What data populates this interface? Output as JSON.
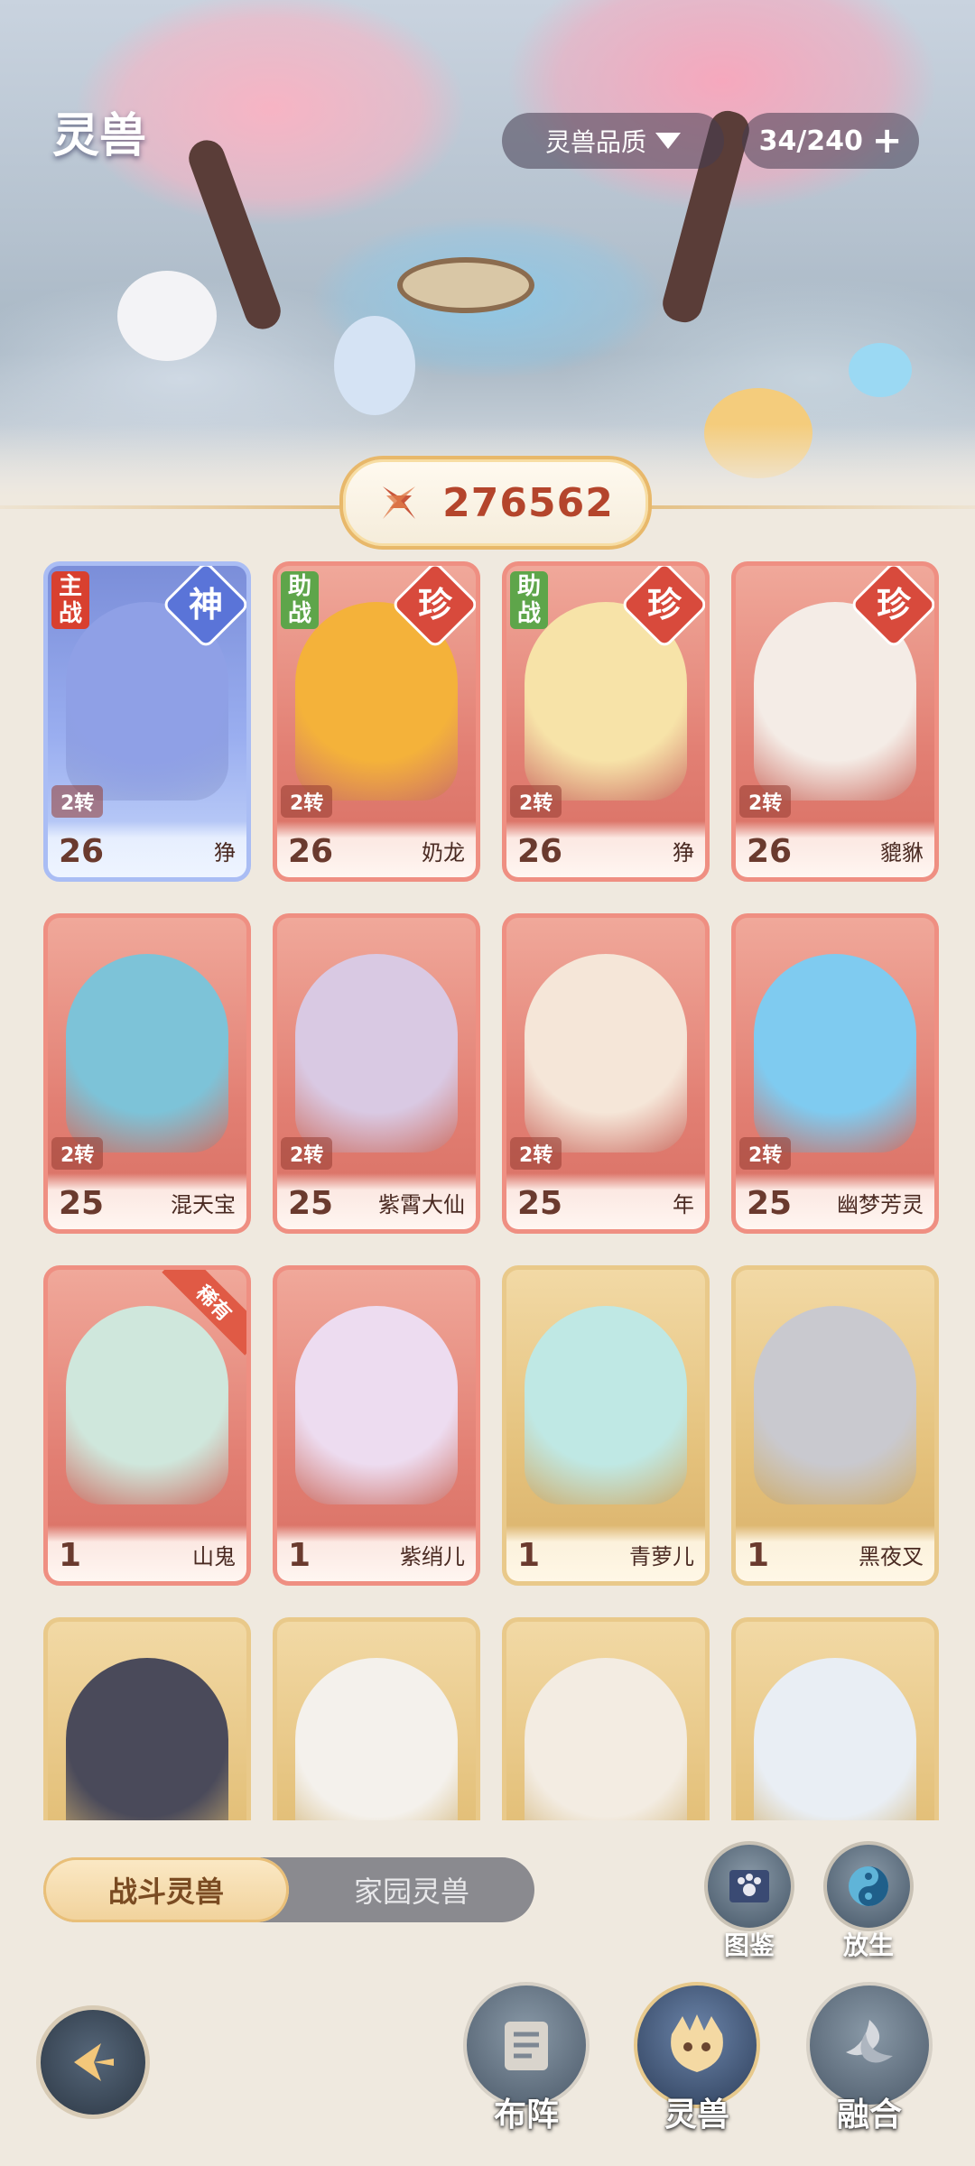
{
  "header": {
    "title": "灵兽",
    "quality_filter": "灵兽品质",
    "capacity": "34/240"
  },
  "power": {
    "value": "276562"
  },
  "cards": [
    {
      "name": "狰",
      "level": "26",
      "rebirth": "2转",
      "tier": "神",
      "role": "主战",
      "style": "blue",
      "color": "#8fa0e6"
    },
    {
      "name": "奶龙",
      "level": "26",
      "rebirth": "2转",
      "tier": "珍",
      "role": "助战",
      "style": "red",
      "color": "#f4b23a"
    },
    {
      "name": "狰",
      "level": "26",
      "rebirth": "2转",
      "tier": "珍",
      "role": "助战",
      "style": "red",
      "color": "#f7e3a8"
    },
    {
      "name": "貔貅",
      "level": "26",
      "rebirth": "2转",
      "tier": "珍",
      "role": "",
      "style": "red",
      "color": "#f4ece6"
    },
    {
      "name": "混天宝",
      "level": "25",
      "rebirth": "2转",
      "tier": "",
      "role": "",
      "style": "red",
      "color": "#7dc3d8"
    },
    {
      "name": "紫霄大仙",
      "level": "25",
      "rebirth": "2转",
      "tier": "",
      "role": "",
      "style": "red",
      "color": "#d9c9e3"
    },
    {
      "name": "年",
      "level": "25",
      "rebirth": "2转",
      "tier": "",
      "role": "",
      "style": "red",
      "color": "#f5e6d8"
    },
    {
      "name": "幽梦芳灵",
      "level": "25",
      "rebirth": "2转",
      "tier": "",
      "role": "",
      "style": "red",
      "color": "#7fcbf0"
    },
    {
      "name": "山鬼",
      "level": "1",
      "rebirth": "",
      "tier": "",
      "role": "",
      "rare": "稀有",
      "style": "red",
      "color": "#cfe7dc"
    },
    {
      "name": "紫绡儿",
      "level": "1",
      "rebirth": "",
      "tier": "",
      "role": "",
      "style": "red",
      "color": "#eddcf0"
    },
    {
      "name": "青萝儿",
      "level": "1",
      "rebirth": "",
      "tier": "",
      "role": "",
      "style": "gold",
      "color": "#bfe8e4"
    },
    {
      "name": "黑夜叉",
      "level": "1",
      "rebirth": "",
      "tier": "",
      "role": "",
      "style": "gold",
      "color": "#c9c9cf"
    },
    {
      "name": "",
      "level": "",
      "rebirth": "",
      "tier": "",
      "role": "",
      "style": "gold",
      "color": "#4a4a5a"
    },
    {
      "name": "",
      "level": "",
      "rebirth": "",
      "tier": "",
      "role": "",
      "style": "gold",
      "color": "#f4f1ec"
    },
    {
      "name": "",
      "level": "",
      "rebirth": "",
      "tier": "",
      "role": "",
      "style": "gold",
      "color": "#f3ece2"
    },
    {
      "name": "",
      "level": "",
      "rebirth": "",
      "tier": "",
      "role": "",
      "style": "gold",
      "color": "#e9eef4"
    }
  ],
  "tabs": {
    "battle": "战斗灵兽",
    "home": "家园灵兽"
  },
  "tools": {
    "codex": "图鉴",
    "release": "放生"
  },
  "nav": {
    "formation": "布阵",
    "beasts": "灵兽",
    "fusion": "融合"
  }
}
